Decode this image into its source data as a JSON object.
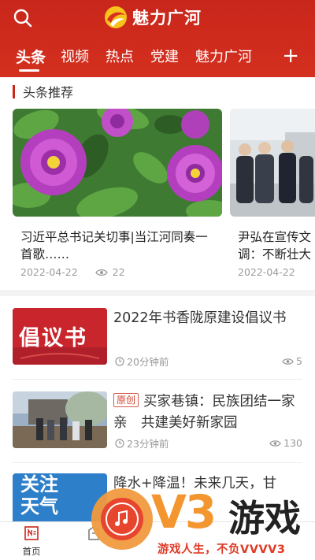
{
  "header": {
    "app_title": "魅力广河",
    "tabs": [
      "头条",
      "视频",
      "热点",
      "党建",
      "魅力广河"
    ],
    "active_tab": "头条",
    "add_symbol": "+"
  },
  "section": {
    "title": "头条推荐"
  },
  "carousel": [
    {
      "title": "习近平总书记关切事|当江河同奏一首歌……",
      "date": "2022-04-22",
      "views": "22"
    },
    {
      "title": "尹弘在宣传文调：不断壮大",
      "date": "2022-04-22",
      "views": ""
    }
  ],
  "news": [
    {
      "thumb_text": "倡议书",
      "title": "2022年书香陇原建设倡议书",
      "time": "20分钟前",
      "views": "5",
      "badge": ""
    },
    {
      "thumb_text": "",
      "title": "买家巷镇：民族团结一家亲　共建美好新家园",
      "time": "23分钟前",
      "views": "130",
      "badge": "原创"
    },
    {
      "thumb_text": "关注天气",
      "title": "降水+降温！未来几天，甘",
      "time": "",
      "views": "",
      "badge": ""
    }
  ],
  "bottom_nav": [
    {
      "label": "首页",
      "icon": "home-icon"
    },
    {
      "label": "",
      "icon": "building-icon"
    }
  ],
  "watermark": {
    "brand": "V3",
    "brand_cn": "游戏",
    "slogan": "游戏人生，不负VVVV3"
  },
  "colors": {
    "brand_red": "#c9261b",
    "meta_gray": "#999999",
    "accent_orange": "#f3962f"
  }
}
